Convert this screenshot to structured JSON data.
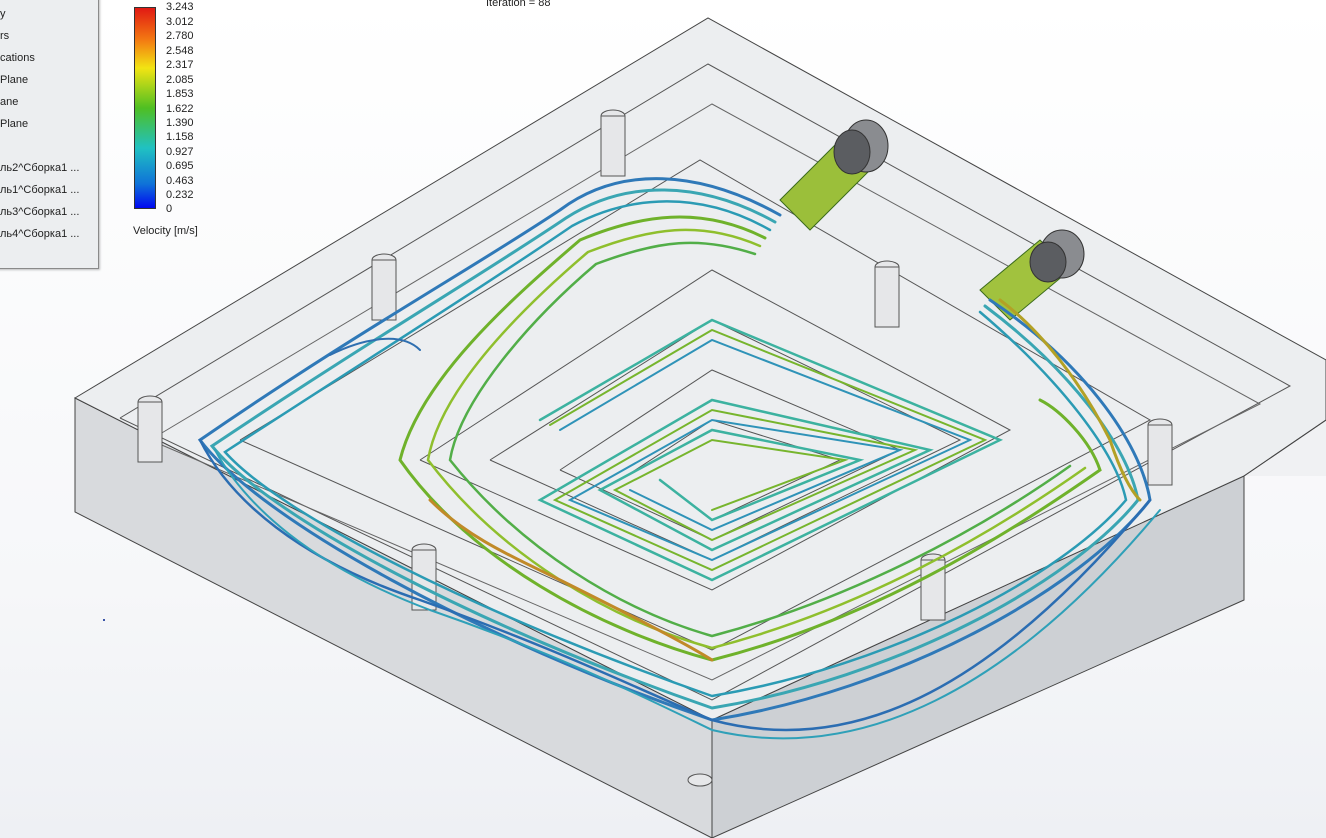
{
  "tree": {
    "items": [
      "y",
      "rs",
      "cations",
      "Plane",
      "ane",
      "Plane",
      "ль2^Сборка1 ...",
      "ль1^Сборка1 ...",
      "ль3^Сборка1 ...",
      "ль4^Сборка1 ..."
    ]
  },
  "status": {
    "iteration": "Iteration = 88"
  },
  "legend": {
    "ticks": [
      "3.243",
      "3.012",
      "2.780",
      "2.548",
      "2.317",
      "2.085",
      "1.853",
      "1.622",
      "1.390",
      "1.158",
      "0.927",
      "0.695",
      "0.463",
      "0.232",
      "0"
    ],
    "label": "Velocity [m/s]",
    "colors": [
      "#e11a13",
      "#f37a12",
      "#f2e413",
      "#4fbf22",
      "#20c1c2",
      "#0f72d8",
      "#0008f0"
    ]
  },
  "scene": {
    "colors": {
      "block_top": "#eef0f2",
      "block_side": "#d9dbde",
      "block_front": "#cfd1d4",
      "flow_fast": "#78b12a",
      "flow_mid": "#33a3b0",
      "flow_slow": "#2e6fb0"
    }
  }
}
